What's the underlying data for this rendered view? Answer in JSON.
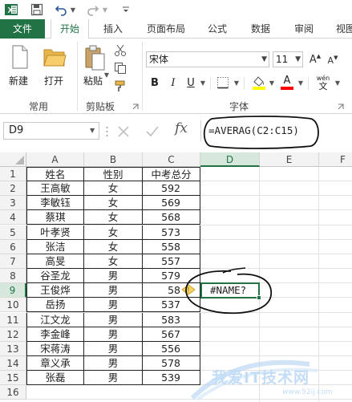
{
  "titlebar": {
    "icons": [
      "excel-logo-icon",
      "save-icon",
      "undo-icon",
      "undo-dropdown-icon",
      "redo-icon",
      "redo-dropdown-icon",
      "customize-quick-access-icon"
    ]
  },
  "tabs": [
    {
      "label": "文件",
      "kind": "file"
    },
    {
      "label": "开始",
      "kind": "active"
    },
    {
      "label": "插入",
      "kind": "normal"
    },
    {
      "label": "页面布局",
      "kind": "normal"
    },
    {
      "label": "公式",
      "kind": "normal"
    },
    {
      "label": "数据",
      "kind": "normal"
    },
    {
      "label": "审阅",
      "kind": "normal"
    },
    {
      "label": "视图",
      "kind": "normal"
    }
  ],
  "ribbon": {
    "new_label": "新建",
    "open_label": "打开",
    "group_common": "常用",
    "paste_label": "粘贴",
    "group_clipboard": "剪贴板",
    "font_name": "宋体",
    "font_size": "11",
    "group_font": "字体",
    "phonetic_label": "wén",
    "bold": "B",
    "italic": "I",
    "underline": "U",
    "grow_font": "A",
    "shrink_font": "A",
    "font_color": "A"
  },
  "formula_bar": {
    "name_box": "D9",
    "formula": "=AVERAG(C2:C15)",
    "fx": "fx"
  },
  "colors": {
    "excel_green": "#217346",
    "fill_yellow": "#ffff00",
    "font_red": "#ff0000"
  },
  "columns": [
    "A",
    "B",
    "C",
    "D",
    "E",
    "F"
  ],
  "selected_column": "D",
  "selected_row": "9",
  "rows": [
    {
      "n": "1",
      "a": "姓名",
      "b": "性别",
      "c": "中考总分"
    },
    {
      "n": "2",
      "a": "王高敏",
      "b": "女",
      "c": "592"
    },
    {
      "n": "3",
      "a": "李敏钰",
      "b": "女",
      "c": "569"
    },
    {
      "n": "4",
      "a": "蔡琪",
      "b": "女",
      "c": "568"
    },
    {
      "n": "5",
      "a": "叶孝贤",
      "b": "女",
      "c": "573"
    },
    {
      "n": "6",
      "a": "张洁",
      "b": "女",
      "c": "558"
    },
    {
      "n": "7",
      "a": "高旻",
      "b": "女",
      "c": "557"
    },
    {
      "n": "8",
      "a": "谷圣龙",
      "b": "男",
      "c": "579"
    },
    {
      "n": "9",
      "a": "王俊烨",
      "b": "男",
      "c": "58"
    },
    {
      "n": "10",
      "a": "岳扬",
      "b": "男",
      "c": "537"
    },
    {
      "n": "11",
      "a": "江文龙",
      "b": "男",
      "c": "583"
    },
    {
      "n": "12",
      "a": "李金峰",
      "b": "男",
      "c": "567"
    },
    {
      "n": "13",
      "a": "宋蒋涛",
      "b": "男",
      "c": "556"
    },
    {
      "n": "14",
      "a": "章义承",
      "b": "男",
      "c": "578"
    },
    {
      "n": "15",
      "a": "张磊",
      "b": "男",
      "c": "539"
    },
    {
      "n": "16",
      "a": "",
      "b": "",
      "c": ""
    }
  ],
  "active_cell": {
    "ref": "D9",
    "value": "#NAME?"
  },
  "watermark": {
    "text": "我爱IT技术网",
    "url": "www.52ij.com"
  }
}
